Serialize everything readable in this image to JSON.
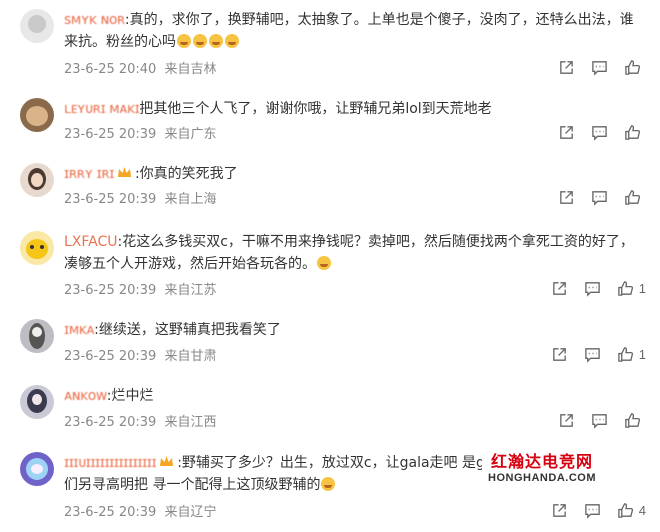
{
  "comments": [
    {
      "username": "ꜱᴍʏᴋ ɴᴏʀ",
      "text": ":真的，求你了，换野辅吧，太抽象了。上单也是个傻子，没肉了，还特么出法，谁来抗。粉丝的心吗",
      "time": "23-6-25 20:40",
      "location": "来自吉林",
      "likes": ""
    },
    {
      "username": "ʟᴇʏᴜʀɪ ᴍᴀᴋɪ",
      "text": "把其他三个人飞了，谢谢你哦，让野辅兄弟lol到天荒地老",
      "time": "23-6-25 20:39",
      "location": "来自广东",
      "likes": ""
    },
    {
      "username": "ɪʀʀʏ ɪʀɪ",
      "text": ":你真的笑死我了",
      "time": "23-6-25 20:39",
      "location": "来自上海",
      "likes": ""
    },
    {
      "username": "LXFACU",
      "text": ":花这么多钱买双c，干嘛不用来挣钱呢？卖掉吧，然后随便找两个拿死工资的好了，凑够五个人开游戏，然后开始各玩各的。",
      "time": "23-6-25 20:39",
      "location": "来自江苏",
      "likes": "1"
    },
    {
      "username": "ɪᴍᴋᴀ",
      "text": ":继续送，这野辅真把我看笑了",
      "time": "23-6-25 20:39",
      "location": "来自甘肃",
      "likes": "1"
    },
    {
      "username": "ᴀɴᴋᴏᴡ",
      "text": ":烂中烂",
      "time": "23-6-25 20:39",
      "location": "来自江西",
      "likes": ""
    },
    {
      "username": "ɪɪɪᴜɪɪɪɪɪɪɪɪɪɪɪɪɪɪɪ",
      "text": ":野辅买了多少？出生，放过双c，让gala走吧 是ga",
      "text2": "们另寻高明把 寻一个配得上这顶级野辅的",
      "time": "23-6-25 20:39",
      "location": "来自辽宁",
      "likes": "4"
    }
  ],
  "watermark": {
    "title": "红瀚达电竞网",
    "url": "HONGHANDA.COM"
  },
  "colors": {
    "username": "#eb7350",
    "meta": "#888888",
    "watermark_red": "#d7000f"
  },
  "icons": [
    "share-icon",
    "comment-icon",
    "like-icon"
  ]
}
